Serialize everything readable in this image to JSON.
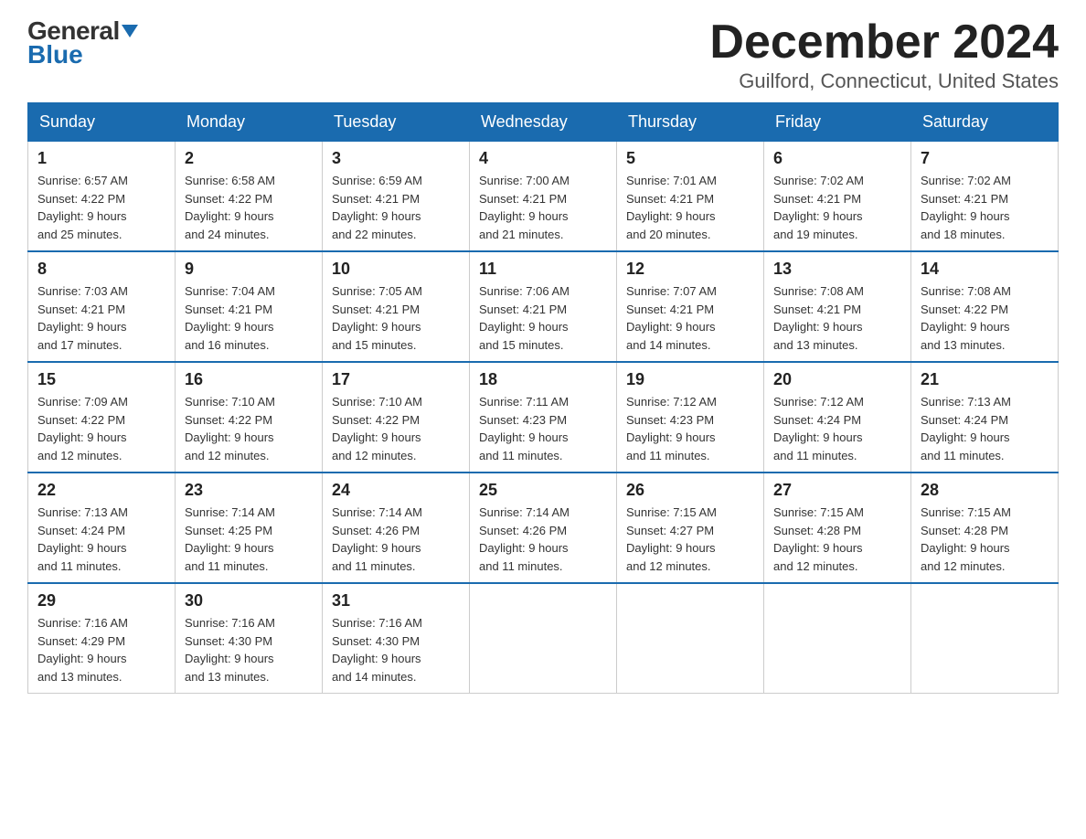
{
  "header": {
    "logo_general": "General",
    "logo_blue": "Blue",
    "month_title": "December 2024",
    "location": "Guilford, Connecticut, United States"
  },
  "weekdays": [
    "Sunday",
    "Monday",
    "Tuesday",
    "Wednesday",
    "Thursday",
    "Friday",
    "Saturday"
  ],
  "weeks": [
    [
      {
        "day": "1",
        "sunrise": "6:57 AM",
        "sunset": "4:22 PM",
        "daylight": "9 hours and 25 minutes."
      },
      {
        "day": "2",
        "sunrise": "6:58 AM",
        "sunset": "4:22 PM",
        "daylight": "9 hours and 24 minutes."
      },
      {
        "day": "3",
        "sunrise": "6:59 AM",
        "sunset": "4:21 PM",
        "daylight": "9 hours and 22 minutes."
      },
      {
        "day": "4",
        "sunrise": "7:00 AM",
        "sunset": "4:21 PM",
        "daylight": "9 hours and 21 minutes."
      },
      {
        "day": "5",
        "sunrise": "7:01 AM",
        "sunset": "4:21 PM",
        "daylight": "9 hours and 20 minutes."
      },
      {
        "day": "6",
        "sunrise": "7:02 AM",
        "sunset": "4:21 PM",
        "daylight": "9 hours and 19 minutes."
      },
      {
        "day": "7",
        "sunrise": "7:02 AM",
        "sunset": "4:21 PM",
        "daylight": "9 hours and 18 minutes."
      }
    ],
    [
      {
        "day": "8",
        "sunrise": "7:03 AM",
        "sunset": "4:21 PM",
        "daylight": "9 hours and 17 minutes."
      },
      {
        "day": "9",
        "sunrise": "7:04 AM",
        "sunset": "4:21 PM",
        "daylight": "9 hours and 16 minutes."
      },
      {
        "day": "10",
        "sunrise": "7:05 AM",
        "sunset": "4:21 PM",
        "daylight": "9 hours and 15 minutes."
      },
      {
        "day": "11",
        "sunrise": "7:06 AM",
        "sunset": "4:21 PM",
        "daylight": "9 hours and 15 minutes."
      },
      {
        "day": "12",
        "sunrise": "7:07 AM",
        "sunset": "4:21 PM",
        "daylight": "9 hours and 14 minutes."
      },
      {
        "day": "13",
        "sunrise": "7:08 AM",
        "sunset": "4:21 PM",
        "daylight": "9 hours and 13 minutes."
      },
      {
        "day": "14",
        "sunrise": "7:08 AM",
        "sunset": "4:22 PM",
        "daylight": "9 hours and 13 minutes."
      }
    ],
    [
      {
        "day": "15",
        "sunrise": "7:09 AM",
        "sunset": "4:22 PM",
        "daylight": "9 hours and 12 minutes."
      },
      {
        "day": "16",
        "sunrise": "7:10 AM",
        "sunset": "4:22 PM",
        "daylight": "9 hours and 12 minutes."
      },
      {
        "day": "17",
        "sunrise": "7:10 AM",
        "sunset": "4:22 PM",
        "daylight": "9 hours and 12 minutes."
      },
      {
        "day": "18",
        "sunrise": "7:11 AM",
        "sunset": "4:23 PM",
        "daylight": "9 hours and 11 minutes."
      },
      {
        "day": "19",
        "sunrise": "7:12 AM",
        "sunset": "4:23 PM",
        "daylight": "9 hours and 11 minutes."
      },
      {
        "day": "20",
        "sunrise": "7:12 AM",
        "sunset": "4:24 PM",
        "daylight": "9 hours and 11 minutes."
      },
      {
        "day": "21",
        "sunrise": "7:13 AM",
        "sunset": "4:24 PM",
        "daylight": "9 hours and 11 minutes."
      }
    ],
    [
      {
        "day": "22",
        "sunrise": "7:13 AM",
        "sunset": "4:24 PM",
        "daylight": "9 hours and 11 minutes."
      },
      {
        "day": "23",
        "sunrise": "7:14 AM",
        "sunset": "4:25 PM",
        "daylight": "9 hours and 11 minutes."
      },
      {
        "day": "24",
        "sunrise": "7:14 AM",
        "sunset": "4:26 PM",
        "daylight": "9 hours and 11 minutes."
      },
      {
        "day": "25",
        "sunrise": "7:14 AM",
        "sunset": "4:26 PM",
        "daylight": "9 hours and 11 minutes."
      },
      {
        "day": "26",
        "sunrise": "7:15 AM",
        "sunset": "4:27 PM",
        "daylight": "9 hours and 12 minutes."
      },
      {
        "day": "27",
        "sunrise": "7:15 AM",
        "sunset": "4:28 PM",
        "daylight": "9 hours and 12 minutes."
      },
      {
        "day": "28",
        "sunrise": "7:15 AM",
        "sunset": "4:28 PM",
        "daylight": "9 hours and 12 minutes."
      }
    ],
    [
      {
        "day": "29",
        "sunrise": "7:16 AM",
        "sunset": "4:29 PM",
        "daylight": "9 hours and 13 minutes."
      },
      {
        "day": "30",
        "sunrise": "7:16 AM",
        "sunset": "4:30 PM",
        "daylight": "9 hours and 13 minutes."
      },
      {
        "day": "31",
        "sunrise": "7:16 AM",
        "sunset": "4:30 PM",
        "daylight": "9 hours and 14 minutes."
      },
      null,
      null,
      null,
      null
    ]
  ],
  "labels": {
    "sunrise": "Sunrise:",
    "sunset": "Sunset:",
    "daylight": "Daylight:"
  }
}
